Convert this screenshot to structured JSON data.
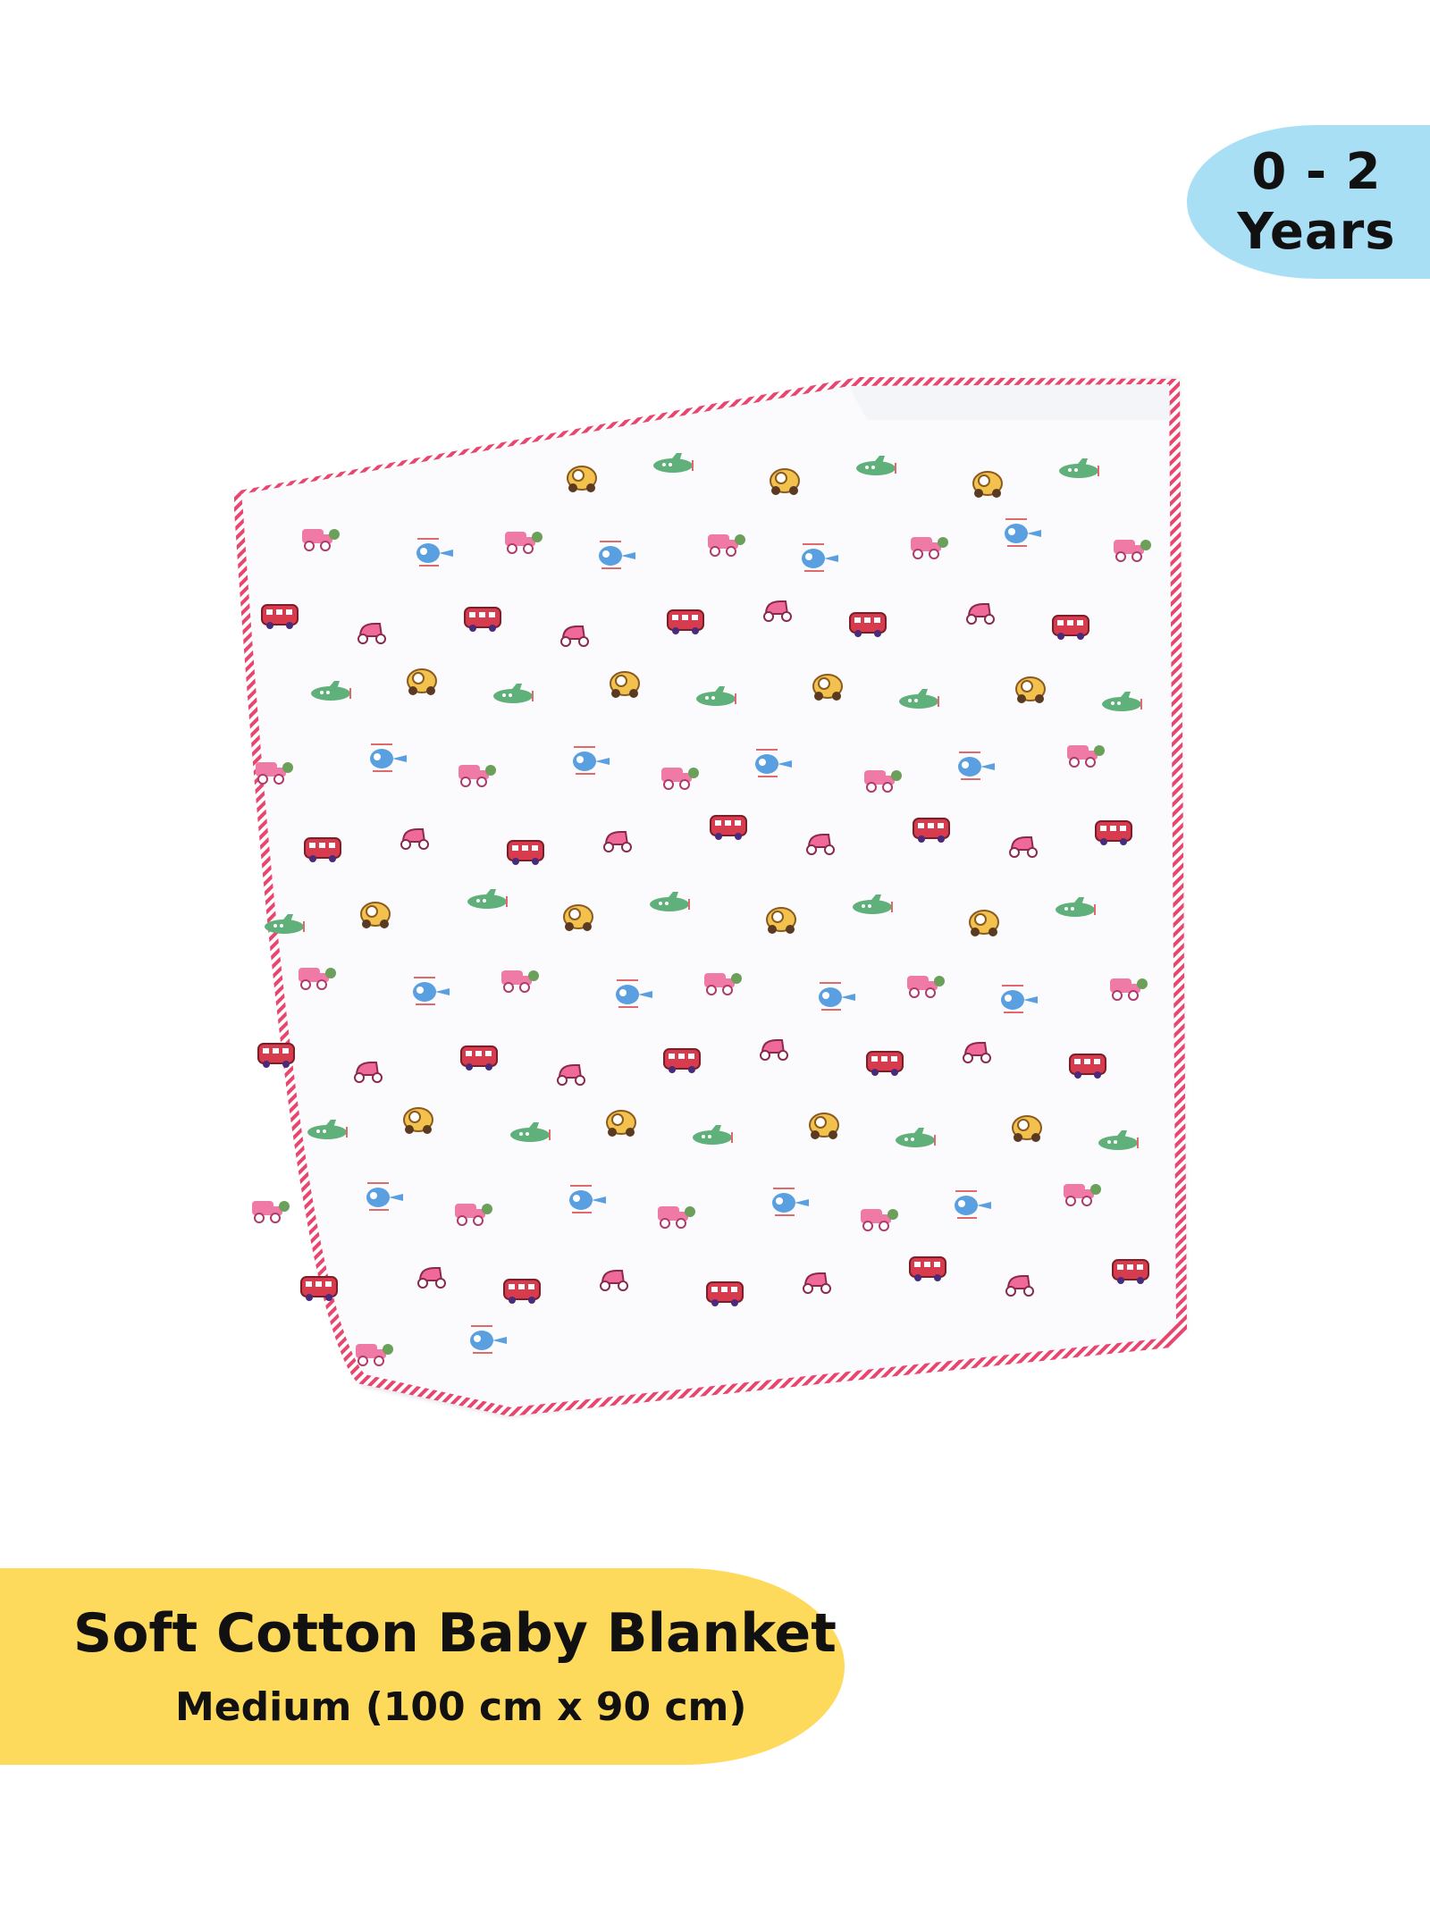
{
  "badge": {
    "line1": "0 - 2",
    "line2": "Years",
    "color": "#a9dff5"
  },
  "product": {
    "title": "Soft Cotton Baby Blanket",
    "size": "Medium (100 cm x 90 cm)",
    "banner_color": "#fdd95c"
  },
  "blanket": {
    "fabric_color": "#fbfbfd",
    "trim_color": "#e8466e",
    "motifs": [
      "car-icon",
      "bus-icon",
      "helicopter-icon",
      "airplane-icon",
      "scooter-icon",
      "truck-icon"
    ]
  }
}
